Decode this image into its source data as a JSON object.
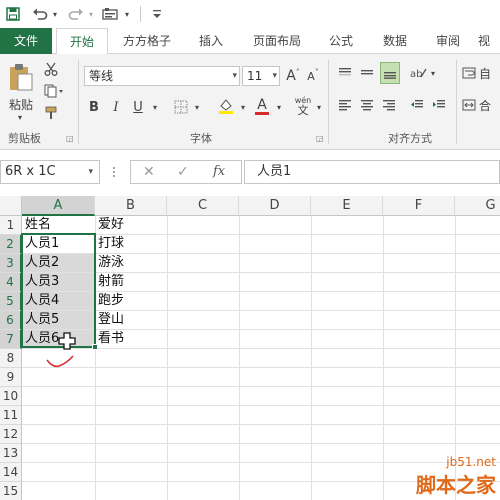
{
  "ribbon_tabs": [
    "文件",
    "开始",
    "方方格子",
    "插入",
    "页面布局",
    "公式",
    "数据",
    "审阅",
    "视"
  ],
  "ribbon": {
    "font_name": "等线",
    "font_size": "11",
    "paste_label": "粘贴",
    "clipboard_label": "剪贴板",
    "font_group_label": "字体",
    "align_group_label": "对齐方式",
    "auto_wrap_partial": "自",
    "merge_partial": "合",
    "wen_label": "wén",
    "wen_char": "文",
    "bold": "B",
    "italic": "I",
    "underline": "U",
    "grow_font": "A",
    "shrink_font": "A",
    "font_color_letter": "A"
  },
  "formula_bar": {
    "name_box": "6R x 1C",
    "cancel": "✕",
    "enter": "✓",
    "fx": "fx",
    "formula": "人员1"
  },
  "columns": [
    "A",
    "B",
    "C",
    "D",
    "E",
    "F",
    "G"
  ],
  "rows": [
    "1",
    "2",
    "3",
    "4",
    "5",
    "6",
    "7",
    "8",
    "9",
    "10",
    "11",
    "12",
    "13",
    "14",
    "15"
  ],
  "cells": {
    "A": [
      "姓名",
      "人员1",
      "人员2",
      "人员3",
      "人员4",
      "人员5",
      "人员6"
    ],
    "B": [
      "爱好",
      "打球",
      "游泳",
      "射箭",
      "跑步",
      "登山",
      "看书"
    ]
  },
  "watermark": {
    "url": "jb51.net",
    "name": "脚本之家"
  },
  "colors": {
    "excel_green": "#217346",
    "watermark_orange": "#e06a1a",
    "annotation_red": "#d9292b"
  }
}
